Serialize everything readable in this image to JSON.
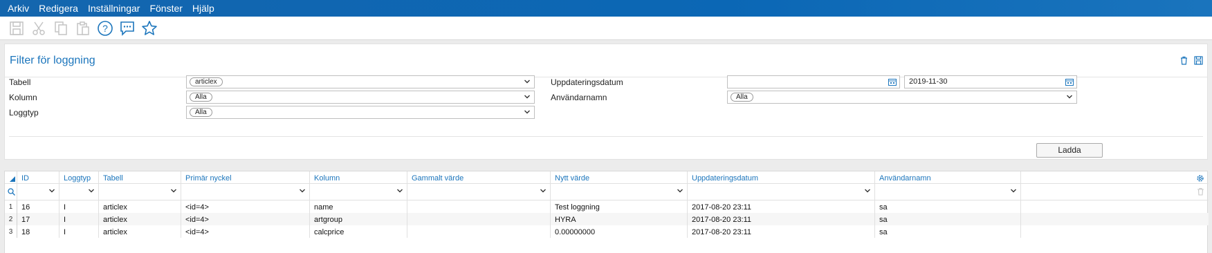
{
  "menu": [
    "Arkiv",
    "Redigera",
    "Inställningar",
    "Fönster",
    "Hjälp"
  ],
  "toolbar": {
    "icons": [
      "save-icon",
      "cut-icon",
      "copy-icon",
      "paste-icon",
      "help-icon",
      "chat-icon",
      "star-icon"
    ]
  },
  "filter": {
    "title": "Filter för loggning",
    "tabell_label": "Tabell",
    "tabell_value": "articlex",
    "kolumn_label": "Kolumn",
    "kolumn_value": "Alla",
    "loggtyp_label": "Loggtyp",
    "loggtyp_value": "Alla",
    "uppdatering_label": "Uppdateringsdatum",
    "date_from": "",
    "date_to": "2019-11-30",
    "anvandare_label": "Användarnamn",
    "anvandare_value": "Alla",
    "load_button": "Ladda"
  },
  "grid": {
    "columns": [
      "ID",
      "Loggtyp",
      "Tabell",
      "Primär nyckel",
      "Kolumn",
      "Gammalt värde",
      "Nytt värde",
      "Uppdateringsdatum",
      "Användarnamn"
    ],
    "rows": [
      {
        "n": "1",
        "cells": [
          "16",
          "I",
          "articlex",
          "<id=4>",
          "name",
          "",
          "Test loggning",
          "2017-08-20 23:11",
          "sa"
        ]
      },
      {
        "n": "2",
        "cells": [
          "17",
          "I",
          "articlex",
          "<id=4>",
          "artgroup",
          "",
          "HYRA",
          "2017-08-20 23:11",
          "sa"
        ]
      },
      {
        "n": "3",
        "cells": [
          "18",
          "I",
          "articlex",
          "<id=4>",
          "calcprice",
          "",
          "0.00000000",
          "2017-08-20 23:11",
          "sa"
        ]
      }
    ]
  },
  "colors": {
    "accent": "#1b75bc",
    "menubar": "#0b67b5"
  }
}
